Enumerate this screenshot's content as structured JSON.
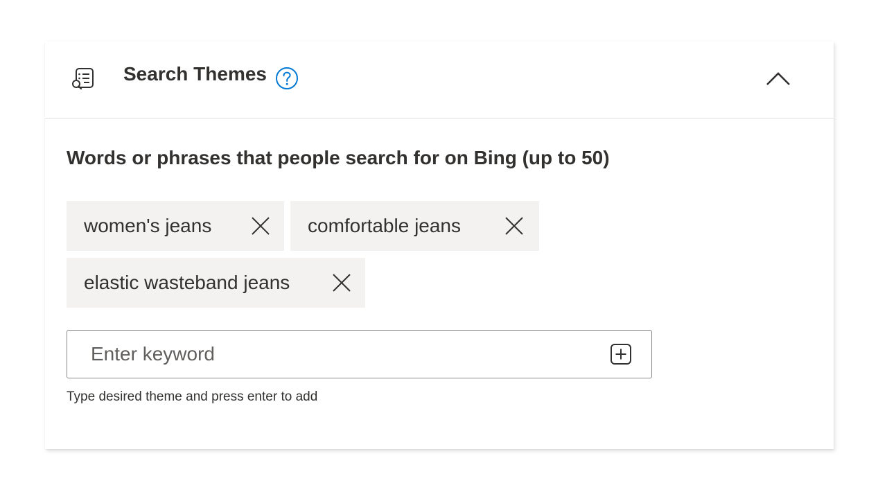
{
  "section": {
    "title": "Search Themes",
    "icon": "search-themes-icon",
    "help_icon": "help-circle-icon",
    "collapse_icon": "chevron-up-icon",
    "accent_color": "#0078d4"
  },
  "themes": {
    "description": "Words or phrases that people search for on Bing (up to 50)",
    "chips": [
      {
        "label": "women's jeans",
        "remove_icon": "close-icon"
      },
      {
        "label": "comfortable jeans",
        "remove_icon": "close-icon"
      },
      {
        "label": "elastic wasteband jeans",
        "remove_icon": "close-icon"
      }
    ],
    "input": {
      "value": "",
      "placeholder": "Enter keyword",
      "add_icon": "add-box-icon"
    },
    "hint": "Type desired theme and press enter to add"
  }
}
